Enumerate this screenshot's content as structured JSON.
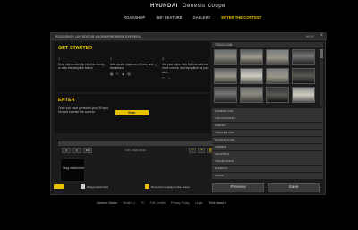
{
  "brand": {
    "logo": "HYUNDAI",
    "model": "Genesis Coupe"
  },
  "nav": [
    {
      "label": "ROADSHOP",
      "active": false
    },
    {
      "label": "360° FEATURE",
      "active": false
    },
    {
      "label": "GALLERY",
      "active": false
    },
    {
      "label": "ENTER THE CONTEST",
      "active": true
    }
  ],
  "app": {
    "title": "ROADSHOP LAP EDITOR  ADOBE PREMIERE EXPRESS",
    "help": "HELP",
    "close": "×"
  },
  "get_started": {
    "heading": "GET STARTED",
    "steps": [
      {
        "num": "1",
        "text": "Drag videos directly into this frame or onto the storyline below."
      },
      {
        "num": "2",
        "text": "Add music, captions, effects, and transitions.",
        "icons": "▦ ✎ ◆ ▤"
      },
      {
        "num": "3",
        "text": "Cut your clips, trick the intervals for more control, and reposition as you wish.",
        "icons": "✂ ↔"
      }
    ]
  },
  "enter": {
    "heading": "ENTER",
    "text": "Once you have perfected your 30 spot, hit save to enter the contest.",
    "button": "Enter"
  },
  "timeline": {
    "rewind": "◂",
    "play": "▸",
    "forward": "▸▸",
    "time": "7:00 / 0:00:30:00",
    "icons": [
      "↶",
      "↷",
      "🗑"
    ]
  },
  "drop_media": "Drag media here",
  "panel": {
    "tab": "TRACK DAB",
    "categories": [
      "CAMERA CAR",
      "CAR MOUNTED",
      "SCENIC",
      "TRIGGER CAR",
      "SLOW MOTION",
      "AMBIENT",
      "GRAPHICS",
      "TRANSITIONS",
      "EFFECTS",
      "MUSIC"
    ]
  },
  "buttons": {
    "preview": "Preview",
    "save": "Save"
  },
  "status": {
    "toggle_label": "",
    "check1_label": "Drag product here",
    "check2_label": "Drop here to apply to ALL scene"
  },
  "footer": [
    {
      "text": "Genesis Sedan",
      "brand": true
    },
    {
      "text": "Model L1"
    },
    {
      "text": "TC"
    },
    {
      "text": "Full Credits"
    },
    {
      "text": "Privacy Policy"
    },
    {
      "text": "Legal"
    },
    {
      "text": "Think About It",
      "brand": true
    }
  ],
  "colors": {
    "accent": "#e6c200",
    "bg": "#000000",
    "panel": "#1b1b1b"
  }
}
